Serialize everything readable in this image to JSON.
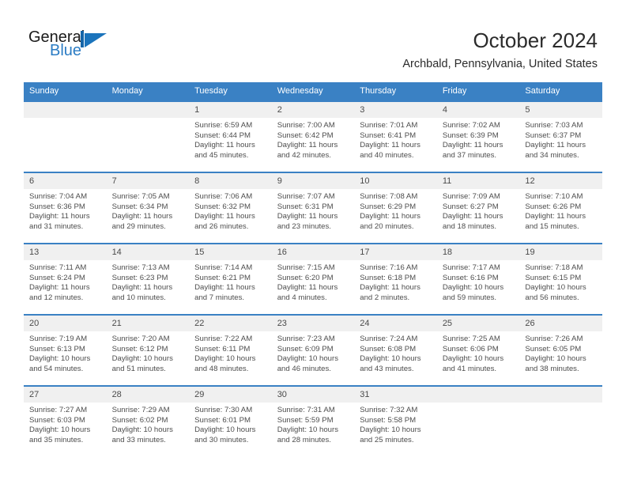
{
  "brand": {
    "name_top": "General",
    "name_bottom": "Blue",
    "mark": "sailboat-logo-icon",
    "accent_color": "#2b7cc4"
  },
  "header": {
    "title": "October 2024",
    "location": "Archbald, Pennsylvania, United States"
  },
  "theme": {
    "header_blue": "#3a81c4",
    "daynum_band": "#f0f0f0",
    "text": "#4d4d4d"
  },
  "calendar": {
    "day_names": [
      "Sunday",
      "Monday",
      "Tuesday",
      "Wednesday",
      "Thursday",
      "Friday",
      "Saturday"
    ],
    "labels": {
      "sunrise": "Sunrise:",
      "sunset": "Sunset:",
      "daylight": "Daylight:"
    },
    "weeks": [
      [
        {
          "day": "",
          "sunrise": "",
          "sunset": "",
          "daylight_1": "",
          "daylight_2": ""
        },
        {
          "day": "",
          "sunrise": "",
          "sunset": "",
          "daylight_1": "",
          "daylight_2": ""
        },
        {
          "day": "1",
          "sunrise": "Sunrise: 6:59 AM",
          "sunset": "Sunset: 6:44 PM",
          "daylight_1": "Daylight: 11 hours",
          "daylight_2": "and 45 minutes."
        },
        {
          "day": "2",
          "sunrise": "Sunrise: 7:00 AM",
          "sunset": "Sunset: 6:42 PM",
          "daylight_1": "Daylight: 11 hours",
          "daylight_2": "and 42 minutes."
        },
        {
          "day": "3",
          "sunrise": "Sunrise: 7:01 AM",
          "sunset": "Sunset: 6:41 PM",
          "daylight_1": "Daylight: 11 hours",
          "daylight_2": "and 40 minutes."
        },
        {
          "day": "4",
          "sunrise": "Sunrise: 7:02 AM",
          "sunset": "Sunset: 6:39 PM",
          "daylight_1": "Daylight: 11 hours",
          "daylight_2": "and 37 minutes."
        },
        {
          "day": "5",
          "sunrise": "Sunrise: 7:03 AM",
          "sunset": "Sunset: 6:37 PM",
          "daylight_1": "Daylight: 11 hours",
          "daylight_2": "and 34 minutes."
        }
      ],
      [
        {
          "day": "6",
          "sunrise": "Sunrise: 7:04 AM",
          "sunset": "Sunset: 6:36 PM",
          "daylight_1": "Daylight: 11 hours",
          "daylight_2": "and 31 minutes."
        },
        {
          "day": "7",
          "sunrise": "Sunrise: 7:05 AM",
          "sunset": "Sunset: 6:34 PM",
          "daylight_1": "Daylight: 11 hours",
          "daylight_2": "and 29 minutes."
        },
        {
          "day": "8",
          "sunrise": "Sunrise: 7:06 AM",
          "sunset": "Sunset: 6:32 PM",
          "daylight_1": "Daylight: 11 hours",
          "daylight_2": "and 26 minutes."
        },
        {
          "day": "9",
          "sunrise": "Sunrise: 7:07 AM",
          "sunset": "Sunset: 6:31 PM",
          "daylight_1": "Daylight: 11 hours",
          "daylight_2": "and 23 minutes."
        },
        {
          "day": "10",
          "sunrise": "Sunrise: 7:08 AM",
          "sunset": "Sunset: 6:29 PM",
          "daylight_1": "Daylight: 11 hours",
          "daylight_2": "and 20 minutes."
        },
        {
          "day": "11",
          "sunrise": "Sunrise: 7:09 AM",
          "sunset": "Sunset: 6:27 PM",
          "daylight_1": "Daylight: 11 hours",
          "daylight_2": "and 18 minutes."
        },
        {
          "day": "12",
          "sunrise": "Sunrise: 7:10 AM",
          "sunset": "Sunset: 6:26 PM",
          "daylight_1": "Daylight: 11 hours",
          "daylight_2": "and 15 minutes."
        }
      ],
      [
        {
          "day": "13",
          "sunrise": "Sunrise: 7:11 AM",
          "sunset": "Sunset: 6:24 PM",
          "daylight_1": "Daylight: 11 hours",
          "daylight_2": "and 12 minutes."
        },
        {
          "day": "14",
          "sunrise": "Sunrise: 7:13 AM",
          "sunset": "Sunset: 6:23 PM",
          "daylight_1": "Daylight: 11 hours",
          "daylight_2": "and 10 minutes."
        },
        {
          "day": "15",
          "sunrise": "Sunrise: 7:14 AM",
          "sunset": "Sunset: 6:21 PM",
          "daylight_1": "Daylight: 11 hours",
          "daylight_2": "and 7 minutes."
        },
        {
          "day": "16",
          "sunrise": "Sunrise: 7:15 AM",
          "sunset": "Sunset: 6:20 PM",
          "daylight_1": "Daylight: 11 hours",
          "daylight_2": "and 4 minutes."
        },
        {
          "day": "17",
          "sunrise": "Sunrise: 7:16 AM",
          "sunset": "Sunset: 6:18 PM",
          "daylight_1": "Daylight: 11 hours",
          "daylight_2": "and 2 minutes."
        },
        {
          "day": "18",
          "sunrise": "Sunrise: 7:17 AM",
          "sunset": "Sunset: 6:16 PM",
          "daylight_1": "Daylight: 10 hours",
          "daylight_2": "and 59 minutes."
        },
        {
          "day": "19",
          "sunrise": "Sunrise: 7:18 AM",
          "sunset": "Sunset: 6:15 PM",
          "daylight_1": "Daylight: 10 hours",
          "daylight_2": "and 56 minutes."
        }
      ],
      [
        {
          "day": "20",
          "sunrise": "Sunrise: 7:19 AM",
          "sunset": "Sunset: 6:13 PM",
          "daylight_1": "Daylight: 10 hours",
          "daylight_2": "and 54 minutes."
        },
        {
          "day": "21",
          "sunrise": "Sunrise: 7:20 AM",
          "sunset": "Sunset: 6:12 PM",
          "daylight_1": "Daylight: 10 hours",
          "daylight_2": "and 51 minutes."
        },
        {
          "day": "22",
          "sunrise": "Sunrise: 7:22 AM",
          "sunset": "Sunset: 6:11 PM",
          "daylight_1": "Daylight: 10 hours",
          "daylight_2": "and 48 minutes."
        },
        {
          "day": "23",
          "sunrise": "Sunrise: 7:23 AM",
          "sunset": "Sunset: 6:09 PM",
          "daylight_1": "Daylight: 10 hours",
          "daylight_2": "and 46 minutes."
        },
        {
          "day": "24",
          "sunrise": "Sunrise: 7:24 AM",
          "sunset": "Sunset: 6:08 PM",
          "daylight_1": "Daylight: 10 hours",
          "daylight_2": "and 43 minutes."
        },
        {
          "day": "25",
          "sunrise": "Sunrise: 7:25 AM",
          "sunset": "Sunset: 6:06 PM",
          "daylight_1": "Daylight: 10 hours",
          "daylight_2": "and 41 minutes."
        },
        {
          "day": "26",
          "sunrise": "Sunrise: 7:26 AM",
          "sunset": "Sunset: 6:05 PM",
          "daylight_1": "Daylight: 10 hours",
          "daylight_2": "and 38 minutes."
        }
      ],
      [
        {
          "day": "27",
          "sunrise": "Sunrise: 7:27 AM",
          "sunset": "Sunset: 6:03 PM",
          "daylight_1": "Daylight: 10 hours",
          "daylight_2": "and 35 minutes."
        },
        {
          "day": "28",
          "sunrise": "Sunrise: 7:29 AM",
          "sunset": "Sunset: 6:02 PM",
          "daylight_1": "Daylight: 10 hours",
          "daylight_2": "and 33 minutes."
        },
        {
          "day": "29",
          "sunrise": "Sunrise: 7:30 AM",
          "sunset": "Sunset: 6:01 PM",
          "daylight_1": "Daylight: 10 hours",
          "daylight_2": "and 30 minutes."
        },
        {
          "day": "30",
          "sunrise": "Sunrise: 7:31 AM",
          "sunset": "Sunset: 5:59 PM",
          "daylight_1": "Daylight: 10 hours",
          "daylight_2": "and 28 minutes."
        },
        {
          "day": "31",
          "sunrise": "Sunrise: 7:32 AM",
          "sunset": "Sunset: 5:58 PM",
          "daylight_1": "Daylight: 10 hours",
          "daylight_2": "and 25 minutes."
        },
        {
          "day": "",
          "sunrise": "",
          "sunset": "",
          "daylight_1": "",
          "daylight_2": ""
        },
        {
          "day": "",
          "sunrise": "",
          "sunset": "",
          "daylight_1": "",
          "daylight_2": ""
        }
      ]
    ]
  }
}
